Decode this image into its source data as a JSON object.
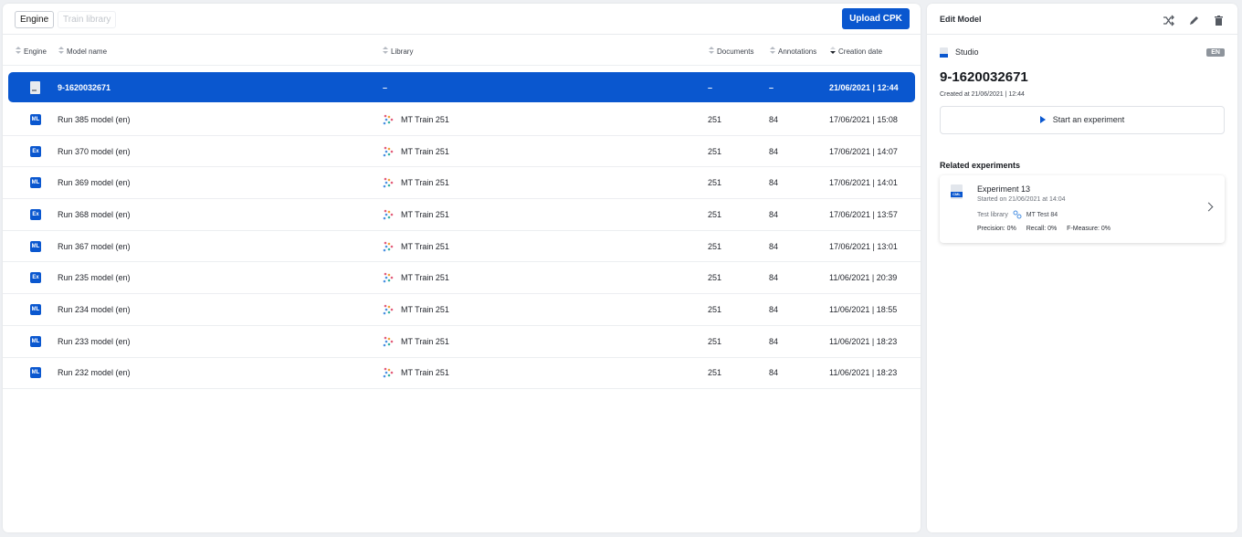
{
  "toolbar": {
    "tabs": [
      {
        "label": "Engine",
        "active": true
      },
      {
        "label": "Train library",
        "active": false
      }
    ],
    "upload_label": "Upload CPK"
  },
  "table": {
    "columns": [
      "Engine",
      "Model name",
      "Library",
      "Documents",
      "Annotations",
      "Creation date"
    ],
    "rows": [
      {
        "engine": "file",
        "name": "9-1620032671",
        "library": "–",
        "documents": "–",
        "annotations": "–",
        "date": "21/06/2021 | 12:44",
        "selected": true
      },
      {
        "engine": "ML",
        "name": "Run 385 model (en)",
        "library": "MT Train 251",
        "documents": "251",
        "annotations": "84",
        "date": "17/06/2021 | 15:08"
      },
      {
        "engine": "Ex",
        "name": "Run 370 model (en)",
        "library": "MT Train 251",
        "documents": "251",
        "annotations": "84",
        "date": "17/06/2021 | 14:07"
      },
      {
        "engine": "ML",
        "name": "Run 369 model (en)",
        "library": "MT Train 251",
        "documents": "251",
        "annotations": "84",
        "date": "17/06/2021 | 14:01"
      },
      {
        "engine": "Ex",
        "name": "Run 368 model (en)",
        "library": "MT Train 251",
        "documents": "251",
        "annotations": "84",
        "date": "17/06/2021 | 13:57"
      },
      {
        "engine": "ML",
        "name": "Run 367 model (en)",
        "library": "MT Train 251",
        "documents": "251",
        "annotations": "84",
        "date": "17/06/2021 | 13:01"
      },
      {
        "engine": "Ex",
        "name": "Run 235 model (en)",
        "library": "MT Train 251",
        "documents": "251",
        "annotations": "84",
        "date": "11/06/2021 | 20:39"
      },
      {
        "engine": "ML",
        "name": "Run 234 model (en)",
        "library": "MT Train 251",
        "documents": "251",
        "annotations": "84",
        "date": "11/06/2021 | 18:55"
      },
      {
        "engine": "ML",
        "name": "Run 233 model (en)",
        "library": "MT Train 251",
        "documents": "251",
        "annotations": "84",
        "date": "11/06/2021 | 18:23"
      },
      {
        "engine": "ML",
        "name": "Run 232 model (en)",
        "library": "MT Train 251",
        "documents": "251",
        "annotations": "84",
        "date": "11/06/2021 | 18:23"
      }
    ]
  },
  "right_panel": {
    "title": "Edit Model",
    "icons": [
      "shuffle-icon",
      "pencil-icon",
      "trash-icon"
    ],
    "engine_name": "Studio",
    "language": "EN",
    "model_title": "9-1620032671",
    "created": "Created at 21/06/2021 | 12:44",
    "start_label": "Start an experiment",
    "related_title": "Related experiments",
    "experiment": {
      "icon_label": "CML",
      "name": "Experiment 13",
      "started": "Started on 21/06/2021 at 14:04",
      "library_label": "Test library",
      "library_name": "MT Test 84",
      "precision": "Precision: 0%",
      "recall": "Recall: 0%",
      "fmeasure": "F-Measure: 0%"
    }
  },
  "colors": {
    "accent": "#0a57cf",
    "background": "#eef0f3"
  }
}
